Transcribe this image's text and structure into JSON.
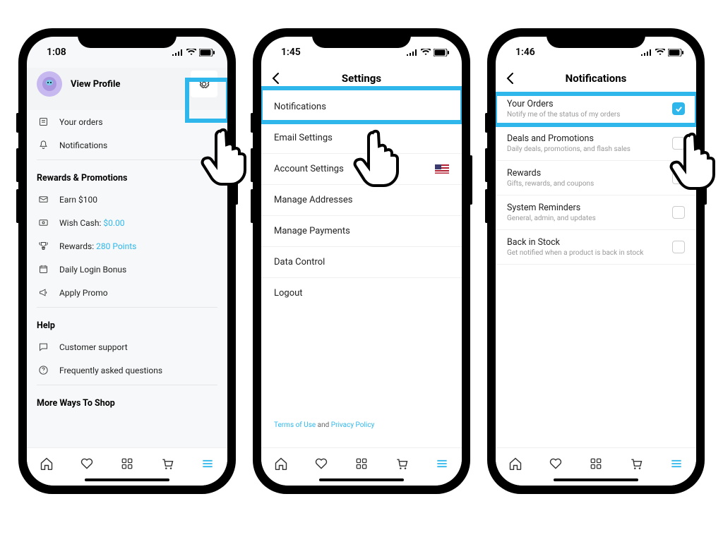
{
  "phone1": {
    "time": "1:08",
    "view_profile": "View Profile",
    "your_orders": "Your orders",
    "notifications": "Notifications",
    "rewards_title": "Rewards & Promotions",
    "earn": "Earn $100",
    "wish_cash_label": "Wish Cash: ",
    "wish_cash_value": "$0.00",
    "rewards_label": "Rewards: ",
    "rewards_value": "280 Points",
    "daily_login": "Daily Login Bonus",
    "apply_promo": "Apply Promo",
    "help_title": "Help",
    "customer_support": "Customer support",
    "faq": "Frequently asked questions",
    "more_ways_title": "More Ways To Shop"
  },
  "phone2": {
    "time": "1:45",
    "title": "Settings",
    "items": {
      "notifications": "Notifications",
      "email": "Email Settings",
      "account": "Account Settings",
      "addresses": "Manage Addresses",
      "payments": "Manage Payments",
      "data": "Data Control",
      "logout": "Logout"
    },
    "footer_terms": "Terms of Use",
    "footer_and": " and ",
    "footer_privacy": "Privacy Policy"
  },
  "phone3": {
    "time": "1:46",
    "title": "Notifications",
    "items": [
      {
        "title": "Your Orders",
        "sub": "Notify me of the status of my orders",
        "checked": true
      },
      {
        "title": "Deals and Promotions",
        "sub": "Daily deals, promotions, and flash sales",
        "checked": false
      },
      {
        "title": "Rewards",
        "sub": "Gifts, rewards, and coupons",
        "checked": false
      },
      {
        "title": "System Reminders",
        "sub": "General, admin, and updates",
        "checked": false
      },
      {
        "title": "Back in Stock",
        "sub": "Get notified when a product is back in stock",
        "checked": false
      }
    ]
  }
}
